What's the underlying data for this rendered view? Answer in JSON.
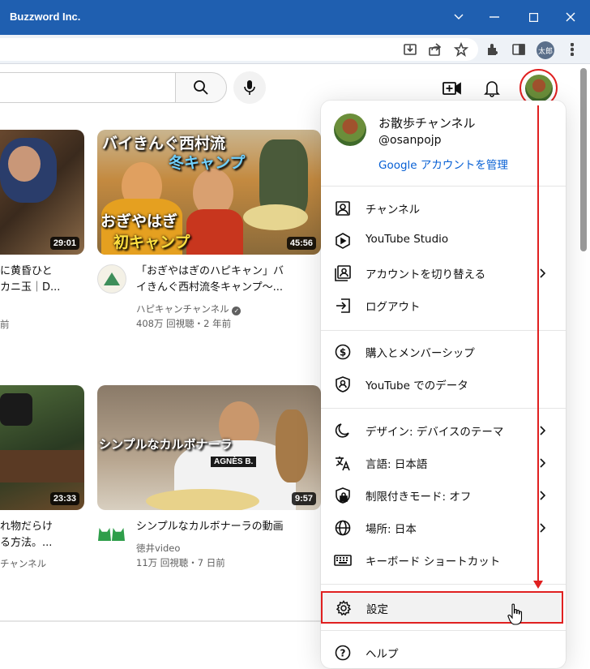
{
  "window": {
    "title": "Buzzword Inc."
  },
  "browser": {
    "profile_label": "太郎"
  },
  "youtube": {
    "search_icon": "search-icon",
    "mic_icon": "mic-icon"
  },
  "videos": [
    {
      "title_line1": "に黄昏ひと",
      "title_line2": "カニ玉｜D...",
      "meta1": "前",
      "meta2": "",
      "duration": "29:01"
    },
    {
      "title_line1": "「おぎやはぎのハピキャン」バ",
      "title_line2": "イきんぐ西村流冬キャンプ〜...",
      "meta1": "ハピキャンチャンネル",
      "meta2": "408万 回視聴・2 年前",
      "duration": "45:56",
      "thumb_text_top": "バイきんぐ西村流",
      "thumb_text_top2": "冬キャンプ",
      "thumb_text_bottom": "おぎやはぎ",
      "thumb_text_bottom2": "初キャンプ"
    },
    {
      "title_line1": "れ物だらけ",
      "title_line2": "る方法。...",
      "meta1": "チャンネル",
      "meta2": "",
      "duration": "23:33"
    },
    {
      "title_line1": "シンプルなカルボナーラの動画",
      "title_line2": "",
      "meta1": "徳井video",
      "meta2": "11万 回視聴・7 日前",
      "duration": "9:57",
      "thumb_text": "シンプルなカルボナーラ",
      "shirt_text": "AGNÈS B."
    }
  ],
  "account": {
    "name": "お散歩チャンネル",
    "handle": "@osanpojp",
    "manage_link": "Google アカウントを管理"
  },
  "menu": {
    "section1": [
      {
        "label": "チャンネル",
        "icon": "person-icon"
      },
      {
        "label": "YouTube Studio",
        "icon": "studio-icon"
      },
      {
        "label": "アカウントを切り替える",
        "icon": "switch-account-icon"
      },
      {
        "label": "ログアウト",
        "icon": "logout-icon"
      }
    ],
    "section2": [
      {
        "label": "購入とメンバーシップ",
        "icon": "dollar-icon"
      },
      {
        "label": "YouTube でのデータ",
        "icon": "shield-person-icon"
      }
    ],
    "section3": [
      {
        "label": "デザイン: デバイスのテーマ",
        "icon": "moon-icon"
      },
      {
        "label": "言語: 日本語",
        "icon": "translate-icon"
      },
      {
        "label": "制限付きモード: オフ",
        "icon": "restricted-icon"
      },
      {
        "label": "場所: 日本",
        "icon": "globe-icon"
      },
      {
        "label": "キーボード ショートカット",
        "icon": "keyboard-icon"
      }
    ],
    "settings": {
      "label": "設定",
      "icon": "gear-icon"
    },
    "help": {
      "label": "ヘルプ",
      "icon": "help-icon"
    }
  },
  "colors": {
    "accent_red": "#e02020",
    "link_blue": "#065fd4",
    "titlebar": "#1f5fb0"
  }
}
